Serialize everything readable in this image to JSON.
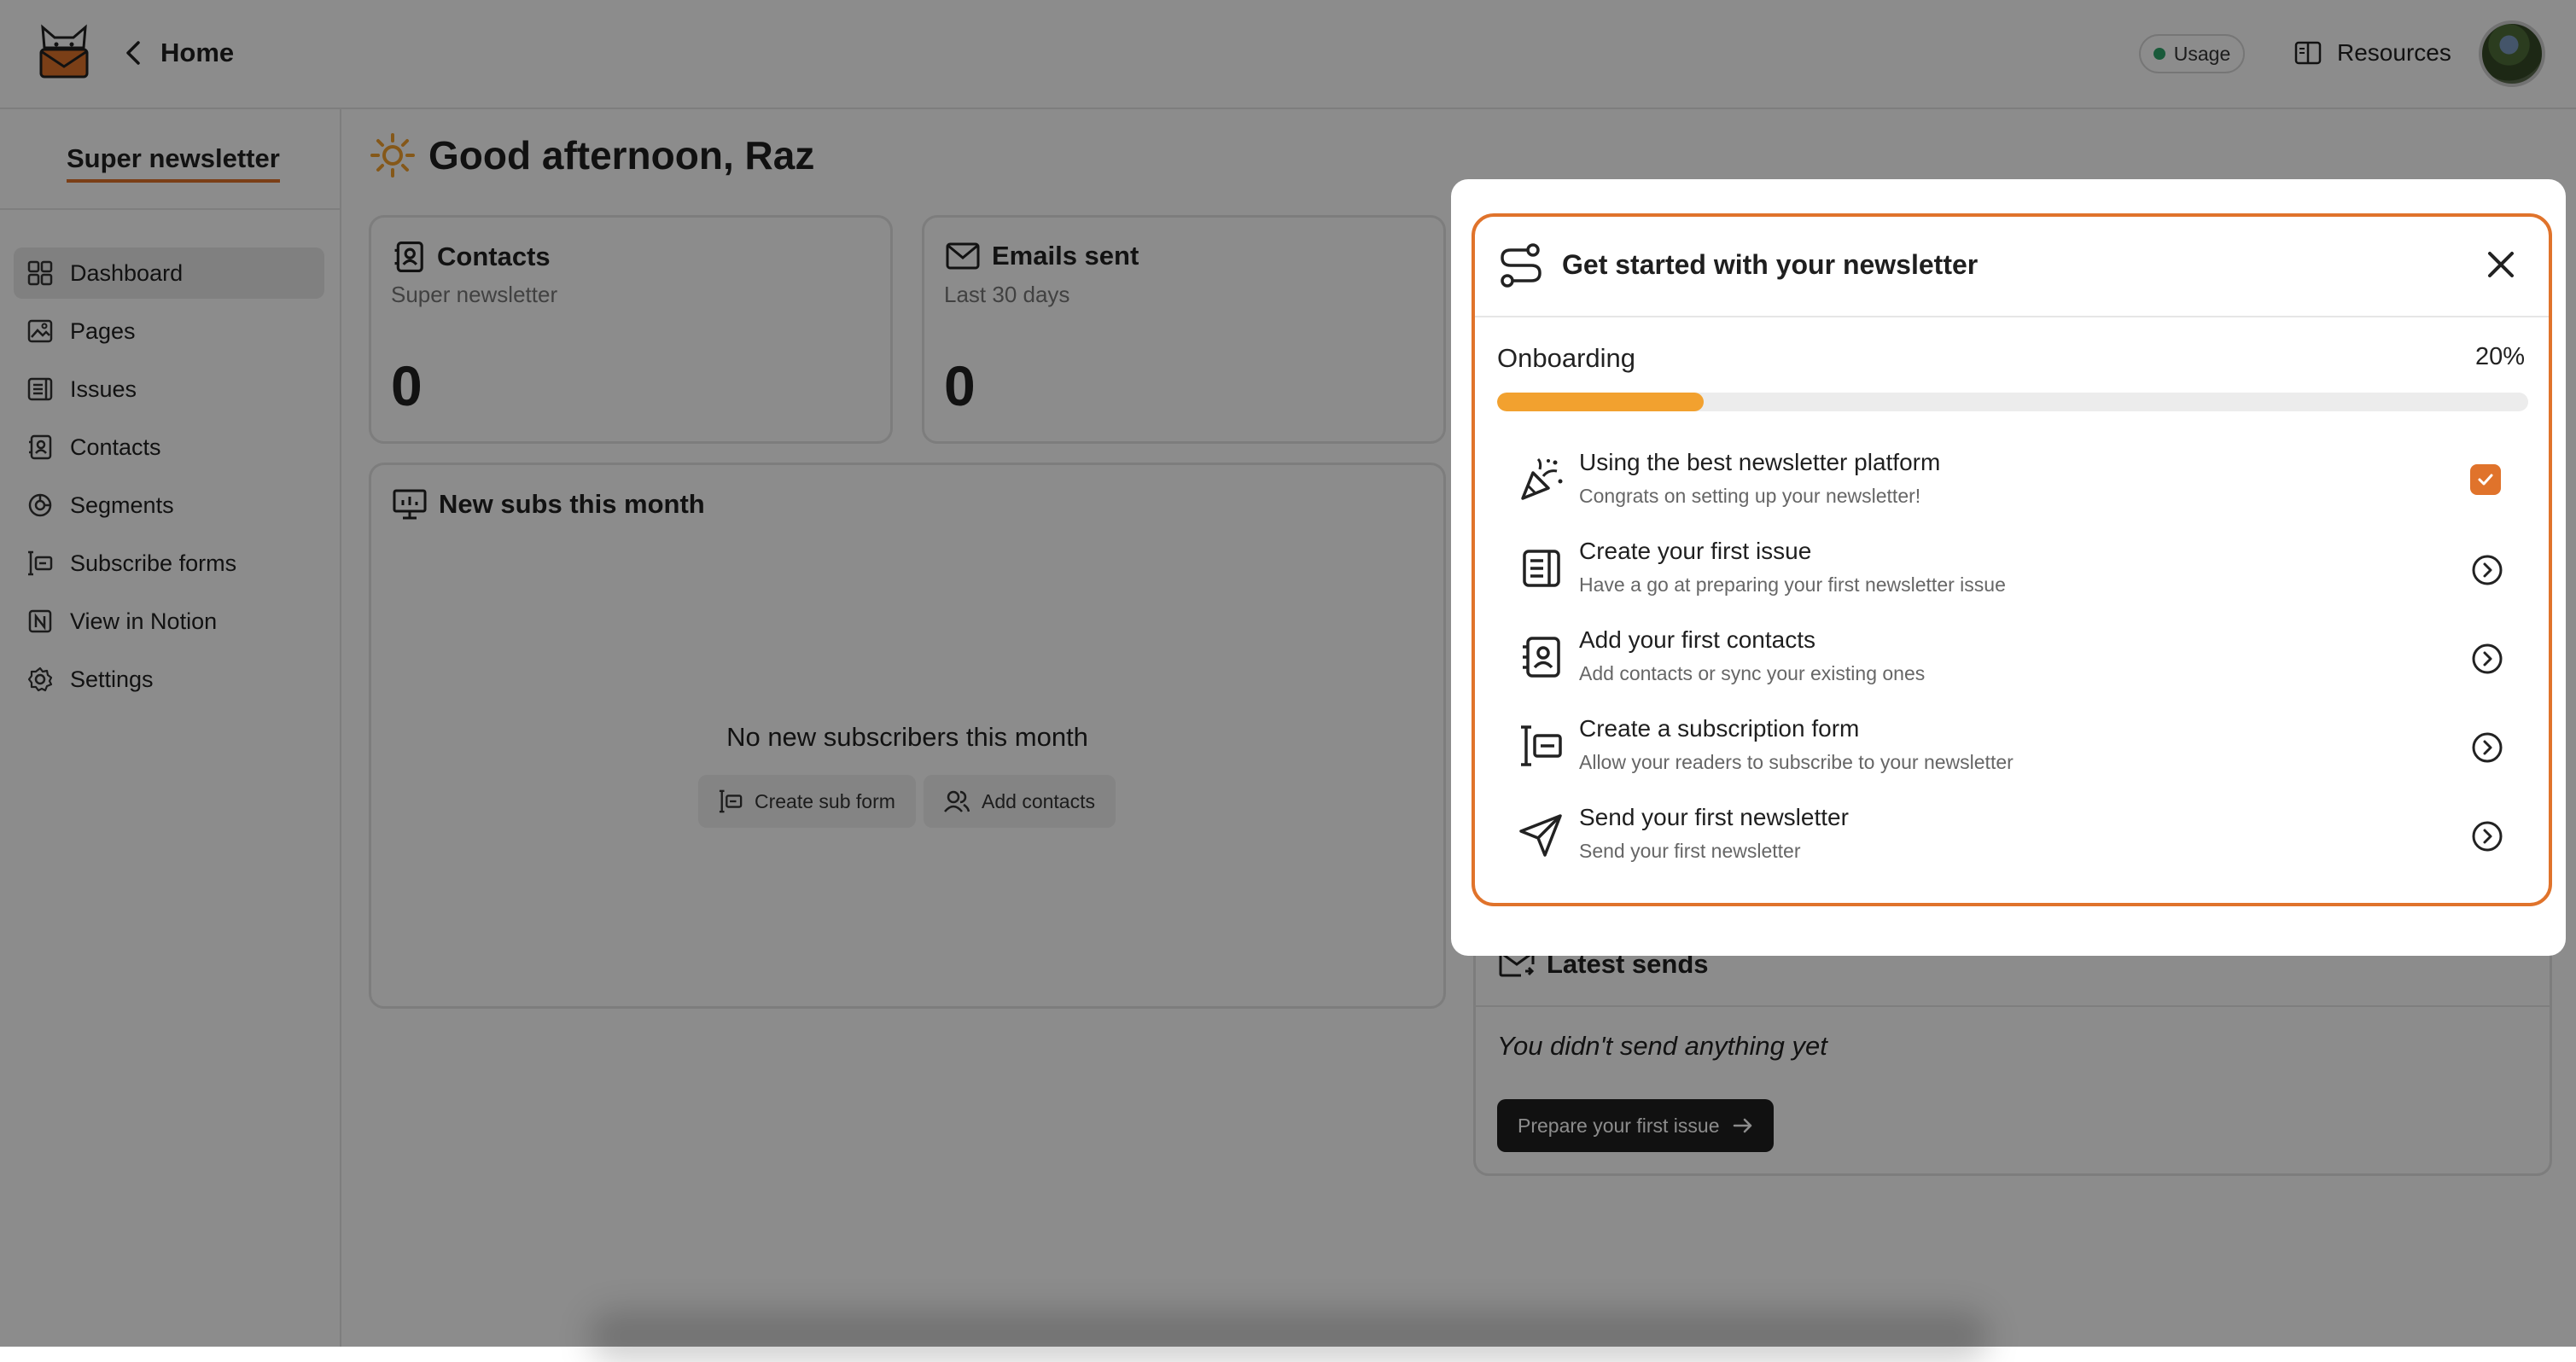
{
  "topbar": {
    "home_label": "Home",
    "usage_label": "Usage",
    "resources_label": "Resources"
  },
  "sidebar": {
    "workspace_name": "Super newsletter",
    "items": [
      {
        "label": "Dashboard",
        "icon": "dashboard-icon",
        "active": true
      },
      {
        "label": "Pages",
        "icon": "pages-icon"
      },
      {
        "label": "Issues",
        "icon": "issues-icon"
      },
      {
        "label": "Contacts",
        "icon": "contacts-icon"
      },
      {
        "label": "Segments",
        "icon": "segments-icon"
      },
      {
        "label": "Subscribe forms",
        "icon": "subscribe-forms-icon"
      },
      {
        "label": "View in Notion",
        "icon": "notion-icon"
      },
      {
        "label": "Settings",
        "icon": "settings-icon"
      }
    ]
  },
  "main": {
    "greeting": "Good afternoon, Raz",
    "contacts_card": {
      "title": "Contacts",
      "subtitle": "Super newsletter",
      "value": "0"
    },
    "emails_card": {
      "title": "Emails sent",
      "subtitle": "Last 30 days",
      "value": "0"
    },
    "subs_card": {
      "title": "New subs this month",
      "empty_text": "No new subscribers this month",
      "create_form_label": "Create sub form",
      "add_contacts_label": "Add contacts"
    },
    "latest_sends": {
      "title": "Latest sends",
      "empty_text": "You didn't send anything yet",
      "button_label": "Prepare your first issue"
    }
  },
  "modal": {
    "title": "Get started with your newsletter",
    "progress_label": "Onboarding",
    "progress_text": "20%",
    "progress_value": 0.2,
    "accent_color": "#e0732b",
    "progress_color": "#f2a12f",
    "steps": [
      {
        "title": "Using the best newsletter platform",
        "desc": "Congrats on setting up your newsletter!",
        "done": true,
        "icon": "party-popper-icon"
      },
      {
        "title": "Create your first issue",
        "desc": "Have a go at preparing your first newsletter issue",
        "done": false,
        "icon": "issue-icon"
      },
      {
        "title": "Add your first contacts",
        "desc": "Add contacts or sync your existing ones",
        "done": false,
        "icon": "contacts-book-icon"
      },
      {
        "title": "Create a subscription form",
        "desc": "Allow your readers to subscribe to your newsletter",
        "done": false,
        "icon": "form-icon"
      },
      {
        "title": "Send your first newsletter",
        "desc": "Send your first newsletter",
        "done": false,
        "icon": "send-icon"
      }
    ]
  }
}
